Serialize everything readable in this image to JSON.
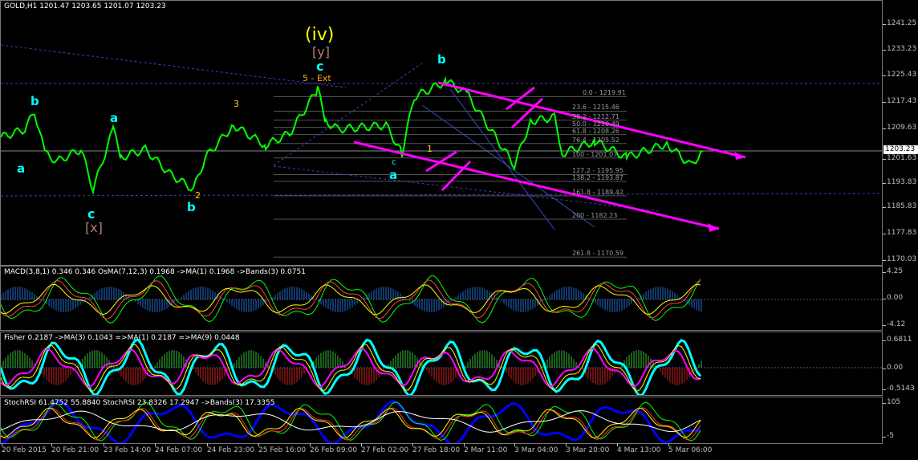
{
  "main": {
    "header": "GOLD,H1   1201.47  1203.65  1201.07  1203.23",
    "current_price": "1203.23",
    "price_ticks": [
      "1241.25",
      "1233.23",
      "1225.43",
      "1217.43",
      "1209.63",
      "1201.63",
      "1193.83",
      "1185.83",
      "1177.83",
      "1170.03"
    ],
    "fib_levels": [
      "0.0 - 1219.91",
      "23.6 - 1215.46",
      "38.2 - 1212.71",
      "50.0 - 1210.49",
      "61.8 - 1208.26",
      "76.4 - 1205.52",
      "100 - 1201.07",
      "127.2 - 1195.95",
      "138.2 - 1193.87",
      "161.8 - 1189.42",
      "200 - 1182.23",
      "261.8 - 1170.59"
    ],
    "wave_labels": {
      "iv_big": "(iv)",
      "y_bracket": "[y]",
      "c_top": "c",
      "ext": "5 - Ext",
      "x_bracket": "[x]",
      "c_bottom": "c",
      "a_left": "a",
      "b_left": "b",
      "a_cyan": "a",
      "b_mid": "b",
      "a_mid": "a",
      "b_right": "b",
      "c_right": "c",
      "n3": "3",
      "n2": "2",
      "n1": "1"
    }
  },
  "macd": {
    "header": "MACD(3,8,1) 0.346 0.346   OsMA(7,12,3) 0.1968   ->MA(1) 0.1968   ->Bands(3) 0.0751",
    "ticks": [
      "4.25",
      "0.00",
      "-4.12"
    ]
  },
  "fisher": {
    "header": "Fisher 0.2187   ->MA(3) 0.1043   =>MA(1) 0.2187   =>MA(9) 0.0448",
    "ticks": [
      "0.6811",
      "0.00",
      "-0.5143"
    ]
  },
  "stochrsi": {
    "header": "StochRSI 61.4752 55.8840   StochRSI 23.8326 17.2947   ->Bands(3) 17.3355",
    "ticks": [
      "105",
      "-5"
    ]
  },
  "time_axis": [
    "20 Feb 2015",
    "20 Feb 21:00",
    "23 Feb 14:00",
    "24 Feb 07:00",
    "24 Feb 23:00",
    "25 Feb 16:00",
    "26 Feb 09:00",
    "27 Feb 02:00",
    "27 Feb 18:00",
    "2 Mar 11:00",
    "3 Mar 04:00",
    "3 Mar 20:00",
    "4 Mar 13:00",
    "5 Mar 06:00"
  ],
  "colors": {
    "price": "#00ff00",
    "trendline": "#ff00ff",
    "wave_cyan": "#00ffff",
    "wave_yellow": "#ffff00",
    "fib": "#9a9a9a"
  }
}
